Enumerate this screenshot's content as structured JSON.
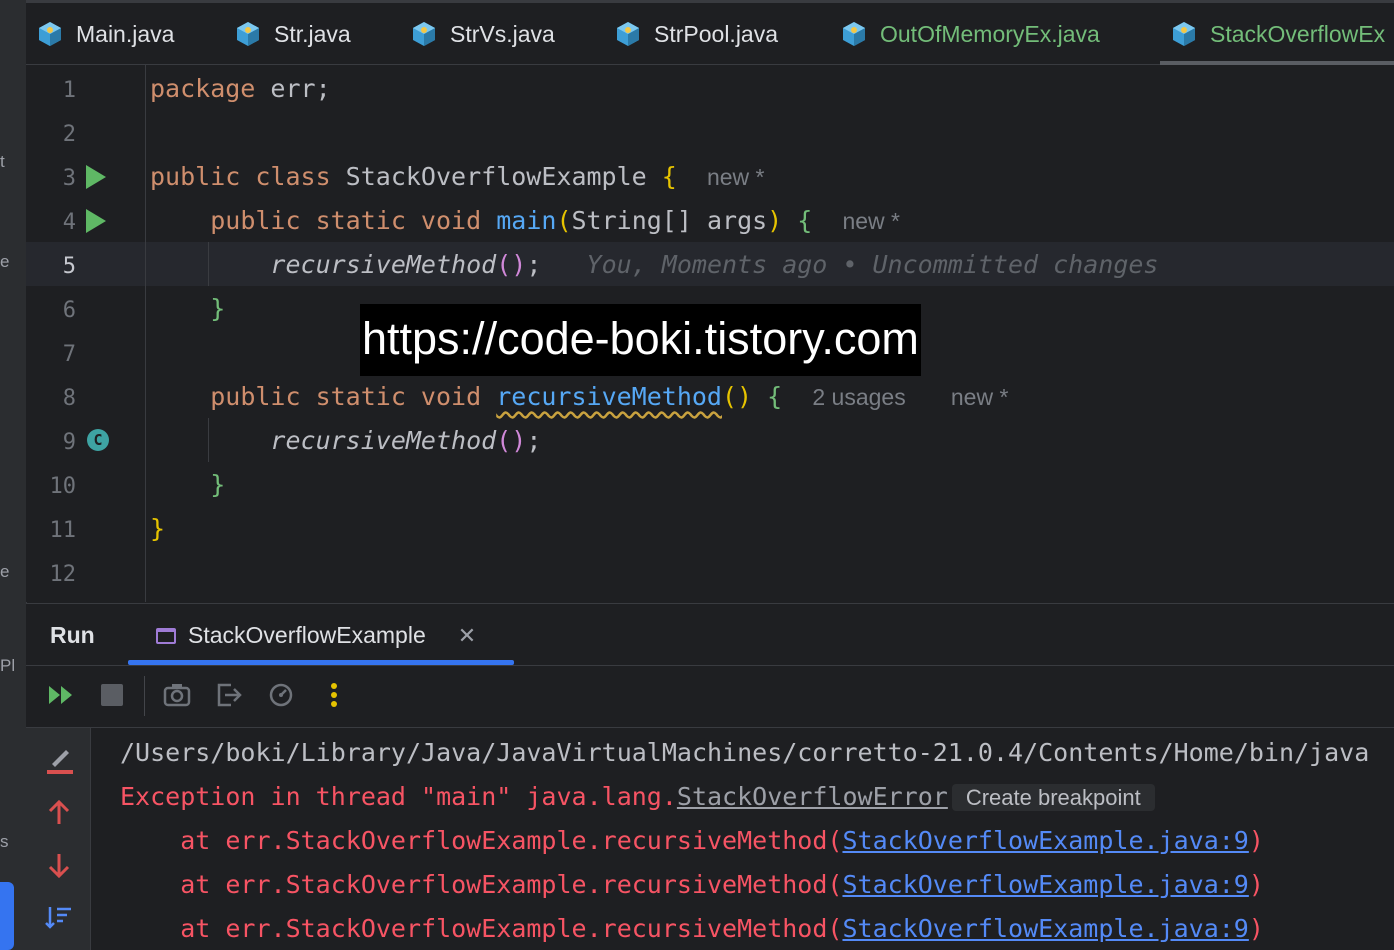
{
  "tabs": [
    {
      "label": "Main.java",
      "state": "normal"
    },
    {
      "label": "Str.java",
      "state": "normal"
    },
    {
      "label": "StrVs.java",
      "state": "normal"
    },
    {
      "label": "StrPool.java",
      "state": "normal"
    },
    {
      "label": "OutOfMemoryEx.java",
      "state": "modified"
    },
    {
      "label": "StackOverflowEx",
      "state": "active"
    }
  ],
  "left_strip": {
    "fragments": [
      "t",
      "e",
      "e",
      "Pl",
      "s"
    ]
  },
  "editor": {
    "line_numbers": [
      "1",
      "2",
      "3",
      "4",
      "5",
      "6",
      "7",
      "8",
      "9",
      "10",
      "11",
      "12"
    ],
    "current_line": "5",
    "code": {
      "l1_kw": "package",
      "l1_rest": " err;",
      "l3_kw": "public class",
      "l3_name": " StackOverflowExample ",
      "l3_brace": "{",
      "l4_kw": "public static void",
      "l4_fn": "main",
      "l4_paren_open": "(",
      "l4_params": "String[] args",
      "l4_paren_close": ")",
      "l4_brace": "{",
      "l5_call": "recursiveMethod",
      "l5_parens": "()",
      "l5_semi": ";",
      "l6_brace": "}",
      "l8_kw": "public static void",
      "l8_fn": "recursiveMethod",
      "l8_parens": "()",
      "l8_brace": "{",
      "l9_call": "recursiveMethod",
      "l9_parens": "()",
      "l9_semi": ";",
      "l10_brace": "}",
      "l11_brace": "}"
    },
    "hints": {
      "l3_new": "new *",
      "l4_new": "new *",
      "l5_blame": "You, Moments ago • Uncommitted changes",
      "l8_usages": "2 usages",
      "l8_new": "new *"
    },
    "recursion_icon": "C"
  },
  "watermark": "https://code-boki.tistory.com",
  "run_panel": {
    "title": "Run",
    "tab_label": "StackOverflowExample",
    "close_glyph": "✕",
    "toolbar_icons": [
      "rerun-icon",
      "stop-icon",
      "camera-icon",
      "exit-icon",
      "profiler-icon",
      "more-icon"
    ],
    "console": {
      "path_line": "/Users/boki/Library/Java/JavaVirtualMachines/corretto-21.0.4/Contents/Home/bin/java",
      "exception_prefix": "Exception in thread \"main\" java.lang.",
      "exception_class": "StackOverflowError",
      "create_breakpoint": "Create breakpoint",
      "trace_prefix": "    at err.StackOverflowExample.recursiveMethod(",
      "trace_link": "StackOverflowExample.java:9",
      "trace_suffix": ")"
    }
  },
  "colors": {
    "keyword": "#cf8e6d",
    "function": "#56a8f5",
    "error": "#f75464",
    "link": "#548af7",
    "accent": "#3574f0",
    "run_green": "#5fb865"
  }
}
